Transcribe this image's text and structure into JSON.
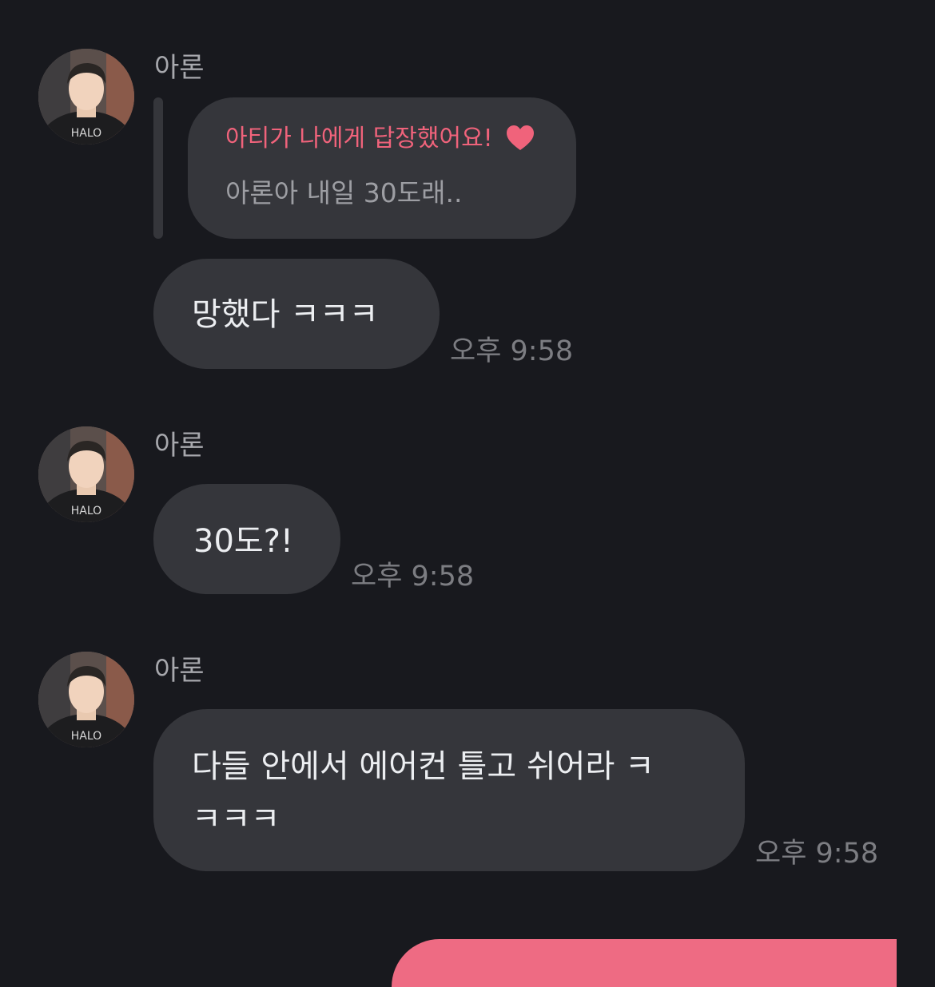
{
  "messages": [
    {
      "sender": "아론",
      "reply": {
        "title": "아티가 나에게 답장했어요!",
        "quote": "아론아 내일 30도래.."
      },
      "text": "망했다 ㅋㅋㅋ",
      "time": "오후 9:58"
    },
    {
      "sender": "아론",
      "text": "30도?!",
      "time": "오후 9:58"
    },
    {
      "sender": "아론",
      "text_line1": "다들 안에서 에어컨 틀고 쉬어라 ㅋ",
      "text_line2": "ㅋㅋㅋ",
      "time": "오후 9:58"
    }
  ],
  "colors": {
    "background": "#18191e",
    "bubble": "#35363b",
    "accent": "#f0637b",
    "outgoing_bubble": "#ee6b83"
  },
  "icons": [
    "profile-avatar",
    "heart-icon"
  ]
}
